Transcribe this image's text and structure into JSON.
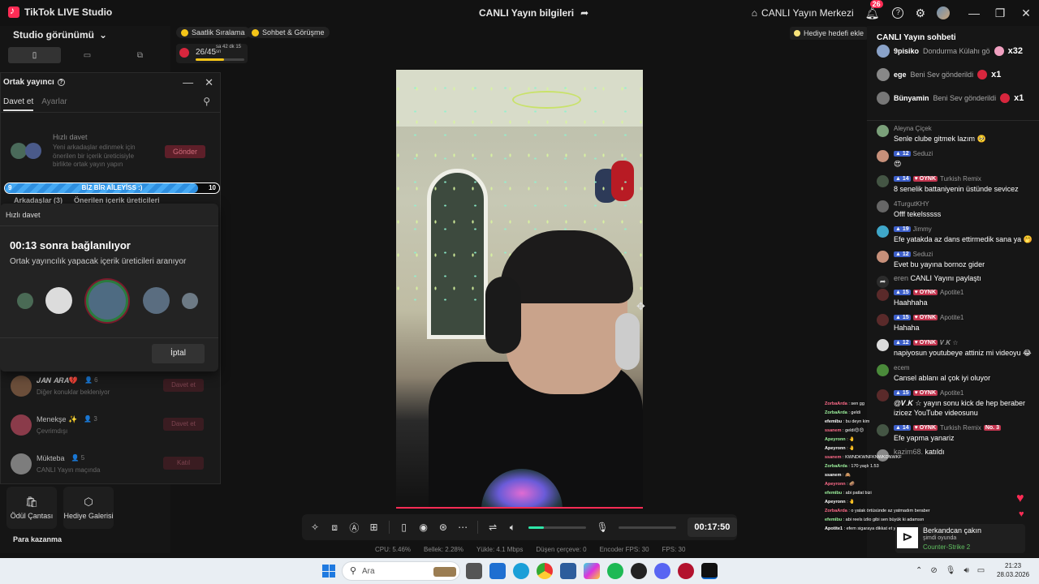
{
  "app": {
    "title": "TikTok LIVE Studio",
    "center_title": "CANLI Yayın bilgileri",
    "live_center": "CANLI Yayın Merkezi",
    "notif_count": "26"
  },
  "left": {
    "studio_view": "Studio görünümü",
    "tools": [
      {
        "label": "Ödül Çantası",
        "icon": "gift-bag-icon"
      },
      {
        "label": "Hediye Galerisi",
        "icon": "gift-gallery-icon"
      }
    ],
    "para_kazanma": "Para kazanma"
  },
  "cohost": {
    "title": "Ortak yayıncı",
    "tab_invite": "Davet et",
    "tab_settings": "Ayarlar",
    "quick_title": "Hızlı davet",
    "quick_desc": "Yeni arkadaşlar edinmek için önerilen bir içerik üreticisiyle birlikte ortak yayın yapın",
    "send": "Gönder",
    "progress": {
      "left": "9",
      "center": "BİZ BİR AİLEYİSS :)",
      "right": "10",
      "fraction": 0.9
    },
    "subtab_friends": "Arkadaşlar (3)",
    "subtab_suggested": "Önerilen içerik üreticileri",
    "friends": [
      {
        "name": "𝑱𝑨𝑵 𝑨𝑹𝑨💔",
        "count": "6",
        "status": "Diğer konuklar bekleniyor",
        "action": "Davet et",
        "color": "#6b4e3a"
      },
      {
        "name": "Menekşe ✨",
        "count": "3",
        "status": "Çevrimdışı",
        "action": "Davet et",
        "color": "#8a3b4a"
      },
      {
        "name": "Mükteba",
        "count": "5",
        "status": "CANLI Yayın maçında",
        "action": "Katıl",
        "color": "#7d7d7d"
      }
    ]
  },
  "qdialog": {
    "header": "Hızlı davet",
    "title": "00:13 sonra bağlanılıyor",
    "subtitle": "Ortak yayıncılık yapacak içerik üreticileri aranıyor",
    "cancel": "İptal"
  },
  "top": {
    "pill1": "Saatlik Sıralama",
    "pill2": "Sohbet & Görüşme",
    "goal_count": "26/45",
    "goal_time": "sa 42 dk 15 sn",
    "goal_fraction": 0.578,
    "gift_goal": "Hediye hedefi ekle"
  },
  "controls": {
    "timer": "00:17:50",
    "volume_fraction": 0.26
  },
  "stats": [
    "CPU:  5.46%",
    "Bellek:  2.28%",
    "Yükle:  4.1 Mbps",
    "Düşen çerçeve:  0",
    "Encoder FPS:  30",
    "FPS:  30"
  ],
  "chat": {
    "title": "CANLI Yayın sohbeti",
    "gifts": [
      {
        "user": "9pisiko",
        "text": "Dondurma Külahı gö",
        "count": "x32",
        "color": "#8aa2c8",
        "gift": "#f0a0c0"
      },
      {
        "user": "ege",
        "text": "Beni Sev gönderildi",
        "count": "x1",
        "color": "#888",
        "gift": "#d7263d"
      },
      {
        "user": "Bünyamin",
        "text": "Beni Sev gönderildi",
        "count": "x1",
        "color": "#777",
        "gift": "#d7263d"
      }
    ],
    "messages": [
      {
        "user": "Aleyna Çiçek",
        "text": "Senle clube gitmek lazım 🥺",
        "lvl": "",
        "fan": "",
        "color": "#7ba07a"
      },
      {
        "user": "Seduzi",
        "text": "😍",
        "lvl": "12",
        "fan": "",
        "color": "#c7907a"
      },
      {
        "user": "Turkish Remix",
        "text": "8 senelik battaniyenin üstünde sevicez",
        "lvl": "14",
        "fan": "OYNK",
        "color": "#445544"
      },
      {
        "user": "4TurgutKHY",
        "text": "Offf tekelsssss",
        "lvl": "",
        "fan": "",
        "color": "#666"
      },
      {
        "user": "Jimmy",
        "text": "Efe yatakda az dans ettirmedik sana ya 🤭",
        "lvl": "19",
        "fan": "",
        "color": "#3fa7c9"
      },
      {
        "user": "Seduzi",
        "text": "Evet bu yayına bornoz gider",
        "lvl": "12",
        "fan": "",
        "color": "#c7907a"
      },
      {
        "user": "Apotite1",
        "text": "Haahhaha",
        "lvl": "15",
        "fan": "OYNK",
        "color": "#5a2a2a"
      },
      {
        "user": "Apotite1",
        "text": "Hahaha",
        "lvl": "15",
        "fan": "OYNK",
        "color": "#5a2a2a"
      },
      {
        "user": "𝑽.𝑲 ☆",
        "text": "napiyosun youtubeye attiniz mi videoyu 😂",
        "lvl": "12",
        "fan": "OYNK",
        "color": "#ddd"
      },
      {
        "user": "ecem",
        "text": "Cansel ablanı al çok iyi oluyor",
        "lvl": "",
        "fan": "",
        "color": "#4a8a3a"
      },
      {
        "user": "Apotite1",
        "text": "@𝑽.𝑲 ☆ yayın sonu kick de hep beraber izicez YouTube videosunu",
        "lvl": "15",
        "fan": "OYNK",
        "color": "#5a2a2a"
      },
      {
        "user": "Turkish Remix",
        "text": "Efe yapma yanariz",
        "lvl": "14",
        "fan": "OYNK",
        "color": "#445544",
        "no": "No. 3"
      }
    ],
    "share_user": "eren",
    "share_text": "CANLI Yayını paylaştı",
    "joined_user": "kazim68.",
    "joined_text": "katıldı"
  },
  "now_playing": {
    "name": "Berkandcan çakın",
    "state": "şimdi oyunda",
    "game": "Counter-Strike 2"
  },
  "overlay_chat": [
    {
      "n": "ZorbaArda",
      "t": ": sen gg"
    },
    {
      "n": "ZorbaArda",
      "t": ": geldi"
    },
    {
      "n": "efemibu",
      "t": ": bu deyn kim"
    },
    {
      "n": "ssanem",
      "t": ": geldi😊😊"
    },
    {
      "n": "Apeyronn",
      "t": ": 🤚"
    },
    {
      "n": "Apeyronn",
      "t": ": 🤚"
    },
    {
      "n": "ssanem",
      "t": ": KWNDKWNFKNWKDNWKF"
    },
    {
      "n": "ZorbaArda",
      "t": ": 170 yaşlı 1.53"
    },
    {
      "n": "ssanem",
      "t": ": 🙈"
    },
    {
      "n": "Apeyronn",
      "t": ": 🥔"
    },
    {
      "n": "efemibu",
      "t": ": abi patlat bizi"
    },
    {
      "n": "Apeyronn",
      "t": ": 🤚"
    },
    {
      "n": "ZorbaArda",
      "t": ": o yatak örtüsünde az yatmadım beraber"
    },
    {
      "n": "efemibu",
      "t": ": abi reels izlio gibi sen büyük ki adamsın"
    },
    {
      "n": "Apotite1",
      "t": ": efem sigaraya dikkat et yoruldu bi at önce"
    }
  ],
  "taskbar": {
    "search": "Ara",
    "time": "21:23",
    "date": "28.03.2026"
  }
}
